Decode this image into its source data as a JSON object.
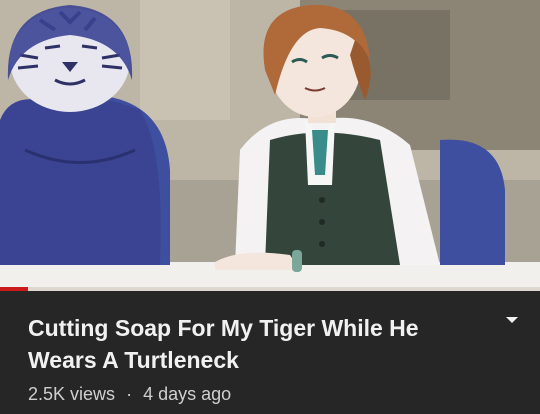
{
  "video": {
    "title": "Cutting Soap For My Tiger While He Wears A Turtleneck",
    "views": "2.5K views",
    "separator": "·",
    "age": "4 days ago",
    "watched_fraction": 0.052,
    "expand_icon": "chevron-down-icon"
  },
  "colors": {
    "accent": "#cc1b1b",
    "panel": "#262626",
    "text_primary": "#f1f1f1",
    "text_secondary": "#cfcfcf"
  }
}
